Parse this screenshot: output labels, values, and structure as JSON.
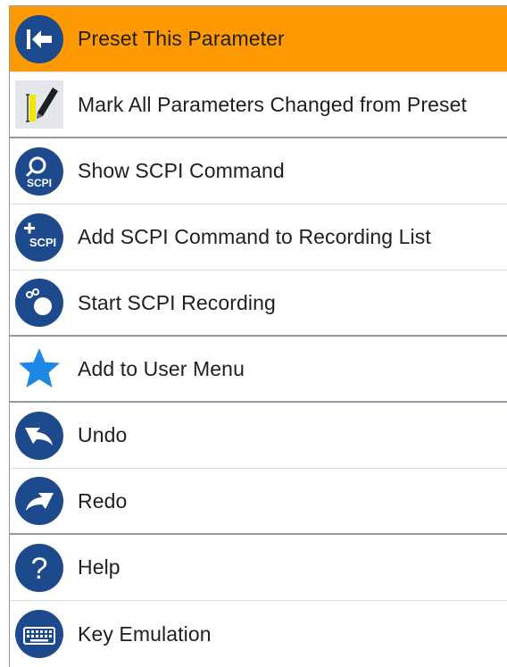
{
  "menu": {
    "items": [
      {
        "label": "Preset This Parameter",
        "icon": "preset-arrow-icon"
      },
      {
        "label": "Mark All Parameters Changed from Preset",
        "icon": "mark-changed-pencil-icon"
      },
      {
        "label": "Show SCPI Command",
        "icon": "scpi-magnifier-icon",
        "icon_text": "SCPI"
      },
      {
        "label": "Add SCPI Command to Recording List",
        "icon": "scpi-plus-icon",
        "icon_text": "SCPI"
      },
      {
        "label": "Start SCPI Recording",
        "icon": "record-icon"
      },
      {
        "label": "Add to User Menu",
        "icon": "star-icon"
      },
      {
        "label": "Undo",
        "icon": "undo-icon"
      },
      {
        "label": "Redo",
        "icon": "redo-icon"
      },
      {
        "label": "Help",
        "icon": "help-icon",
        "icon_text": "?"
      },
      {
        "label": "Key Emulation",
        "icon": "keyboard-icon"
      }
    ]
  },
  "colors": {
    "highlight": "#ff9900",
    "icon_blue": "#1d4a8c",
    "star_blue": "#1e88e5",
    "text": "#1f1f1f"
  }
}
